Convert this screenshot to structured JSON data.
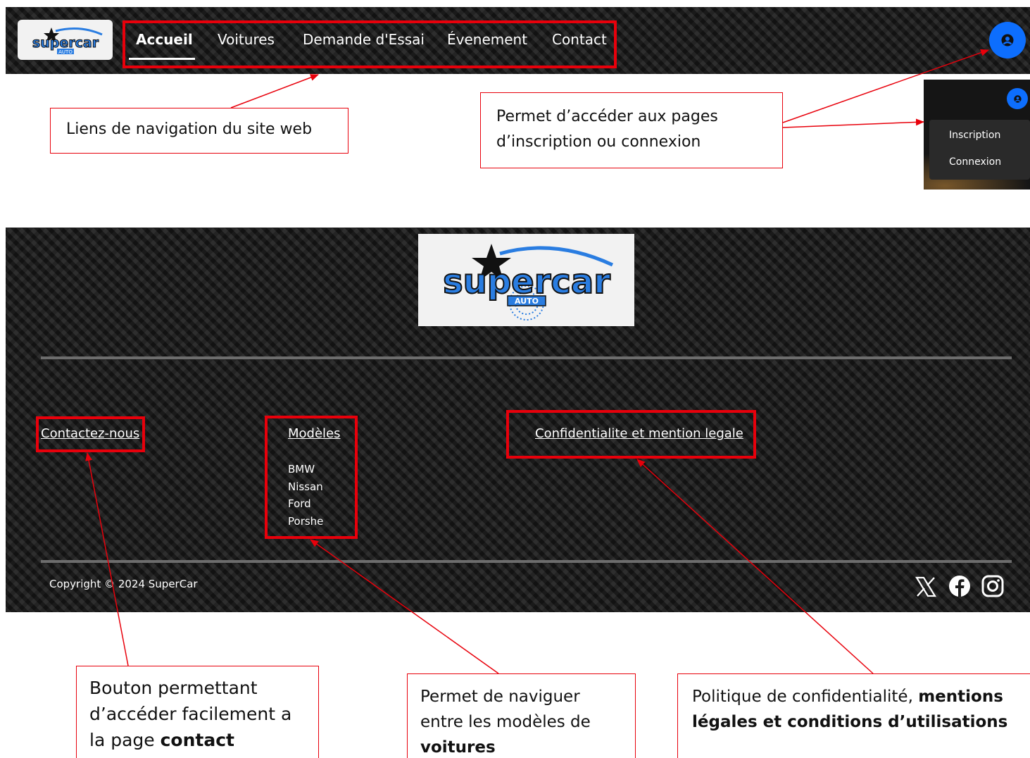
{
  "navbar": {
    "links": [
      "Accueil",
      "Voitures",
      "Demande d'Essai",
      "Évenement",
      "Contact"
    ],
    "active_index": 0,
    "logo_text": "supercar",
    "logo_sub": "AUTO"
  },
  "dropdown": {
    "items": [
      "Inscription",
      "Connexion"
    ]
  },
  "callouts": {
    "nav": "Liens de navigation du site web",
    "account": "Permet d’accéder aux pages d’inscription ou connexion",
    "contact": {
      "pre": "Bouton permettant d’accéder facilement a la page ",
      "bold": "contact"
    },
    "models": {
      "pre": "Permet de naviguer entre les modèles de ",
      "bold": "voitures"
    },
    "legal": {
      "pre": "Politique de confidentialité, ",
      "bold": "mentions légales et conditions d’utilisations"
    }
  },
  "footer": {
    "logo_text": "supercar",
    "logo_sub": "AUTO",
    "contact_link": "Contactez-nous",
    "models_heading": "Modèles",
    "models": [
      "BMW",
      "Nissan",
      "Ford",
      "Porshe"
    ],
    "legal_link": "Confidentialite et mention legale",
    "copyright": "Copyright © 2024 SuperCar",
    "social": [
      "x-icon",
      "facebook-icon",
      "instagram-icon"
    ]
  },
  "colors": {
    "annotation_red": "#e8000b",
    "account_blue": "#0d6efd",
    "logo_blue": "#2a7de1"
  }
}
